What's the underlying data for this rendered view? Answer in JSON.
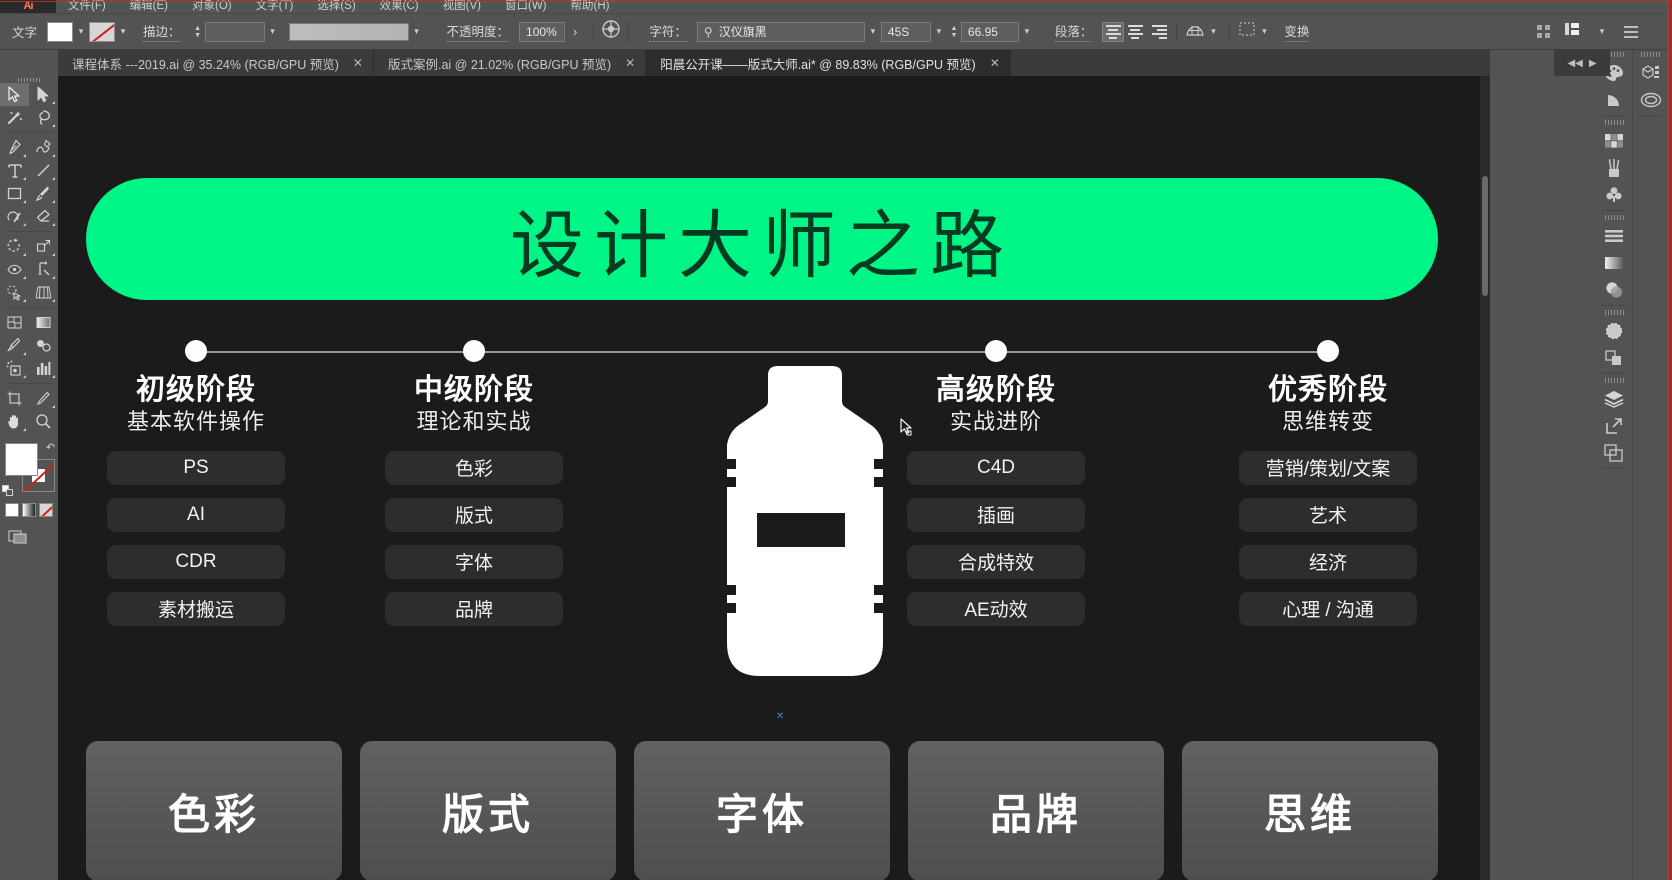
{
  "app": {
    "name": "Adobe Illustrator",
    "menu_items": [
      "文件(F)",
      "编辑(E)",
      "对象(O)",
      "文字(T)",
      "选择(S)",
      "效果(C)",
      "视图(V)",
      "窗口(W)",
      "帮助(H)"
    ]
  },
  "control_bar": {
    "tool_label": "文字",
    "fill_swatch_label": "fill-white",
    "stroke_swatch_label": "stroke-none",
    "stroke_label": "描边：",
    "stroke_weight": "",
    "gradient_value": "",
    "opacity_label": "不透明度：",
    "opacity_value": "100%",
    "opacity_more": "›",
    "char_label": "字符：",
    "font_family": "汉仪旗黑",
    "font_style": "45S",
    "font_size": "66.95",
    "paragraph_label": "段落：",
    "transform_label": "变换",
    "align_left_label": "align-left",
    "align_center_label": "align-center",
    "align_right_label": "align-right"
  },
  "tabs": [
    {
      "label": "课程体系  ---2019.ai @ 35.24% (RGB/GPU 预览)",
      "active": false,
      "close": "✕"
    },
    {
      "label": "版式案例.ai @ 21.02% (RGB/GPU 预览)",
      "active": false,
      "close": "✕"
    },
    {
      "label": "阳晨公开课——版式大师.ai* @ 89.83% (RGB/GPU 预览)",
      "active": true,
      "close": "✕"
    }
  ],
  "tools": [
    {
      "name": "selection-tool",
      "selected": true
    },
    {
      "name": "direct-selection-tool",
      "selected": false
    },
    {
      "name": "magic-wand-tool",
      "selected": false
    },
    {
      "name": "lasso-tool",
      "selected": false
    },
    {
      "name": "pen-tool",
      "selected": false
    },
    {
      "name": "curvature-tool",
      "selected": false
    },
    {
      "name": "type-tool",
      "selected": false
    },
    {
      "name": "line-segment-tool",
      "selected": false
    },
    {
      "name": "rectangle-tool",
      "selected": false
    },
    {
      "name": "paintbrush-tool",
      "selected": false
    },
    {
      "name": "shaper-tool",
      "selected": false
    },
    {
      "name": "eraser-tool",
      "selected": false
    },
    {
      "name": "rotate-tool",
      "selected": false
    },
    {
      "name": "scale-tool",
      "selected": false
    },
    {
      "name": "width-tool",
      "selected": false
    },
    {
      "name": "free-transform-tool",
      "selected": false
    },
    {
      "name": "shape-builder-tool",
      "selected": false
    },
    {
      "name": "perspective-grid-tool",
      "selected": false
    },
    {
      "name": "mesh-tool",
      "selected": false
    },
    {
      "name": "gradient-tool",
      "selected": false
    },
    {
      "name": "eyedropper-tool",
      "selected": false
    },
    {
      "name": "blend-tool",
      "selected": false
    },
    {
      "name": "symbol-sprayer-tool",
      "selected": false
    },
    {
      "name": "column-graph-tool",
      "selected": false
    },
    {
      "name": "artboard-tool",
      "selected": false
    },
    {
      "name": "slice-tool",
      "selected": false
    },
    {
      "name": "hand-tool",
      "selected": false
    },
    {
      "name": "zoom-tool",
      "selected": false
    }
  ],
  "right_dock": {
    "column_a": [
      "color-panel-icon",
      "color-guide-icon",
      "swatches-panel-icon",
      "brushes-panel-icon",
      "symbols-panel-icon",
      "align-panel-icon",
      "gradient-panel-icon",
      "transparency-panel-icon",
      "appearance-panel-icon",
      "pathfinder-panel-icon",
      "layers-panel-icon",
      "artboards-panel-icon",
      "asset-export-panel-icon"
    ],
    "column_b": [
      "libraries-panel-icon",
      "creative-cloud-icon"
    ]
  },
  "canvas": {
    "banner_title": "设计大师之路",
    "banner_color": "#00f587",
    "banner_text_color": "#063b21",
    "background_color": "#1b1b1b",
    "timeline_dots": 4,
    "stages": [
      {
        "title": "初级阶段",
        "subtitle": "基本软件操作",
        "pills": [
          "PS",
          "AI",
          "CDR",
          "素材搬运"
        ]
      },
      {
        "title": "中级阶段",
        "subtitle": "理论和实战",
        "pills": [
          "色彩",
          "版式",
          "字体",
          "品牌"
        ]
      },
      {
        "title": "高级阶段",
        "subtitle": "实战进阶",
        "pills": [
          "C4D",
          "插画",
          "合成特效",
          "AE动效"
        ]
      },
      {
        "title": "优秀阶段",
        "subtitle": "思维转变",
        "pills": [
          "营销/策划/文案",
          "艺术",
          "经济",
          "心理 / 沟通"
        ]
      }
    ],
    "center_graphic": "water-bottle-silhouette",
    "bottom_cards": [
      "色彩",
      "版式",
      "字体",
      "品牌",
      "思维"
    ]
  }
}
